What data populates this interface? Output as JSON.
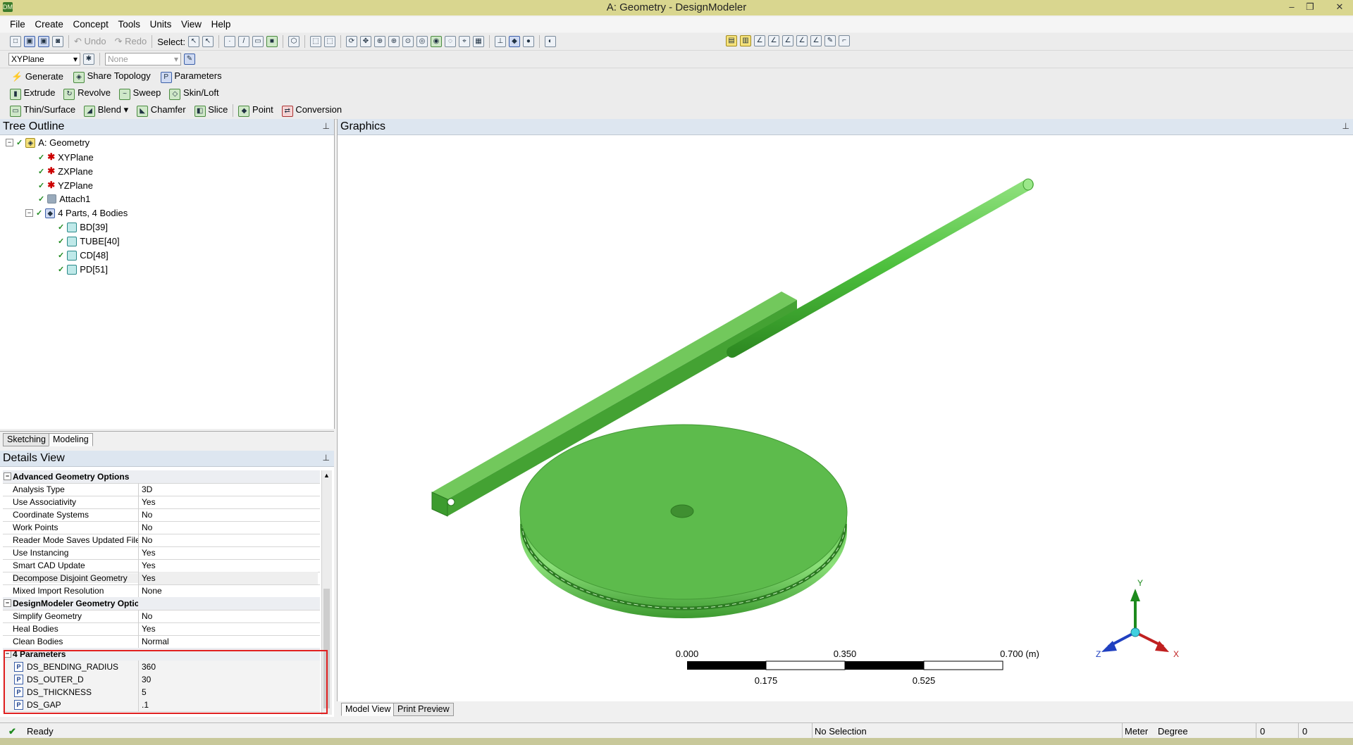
{
  "window": {
    "title": "A: Geometry - DesignModeler",
    "app_icon": "DM",
    "minimize": "–",
    "restore": "❐",
    "close": "✕"
  },
  "menu": [
    "File",
    "Create",
    "Concept",
    "Tools",
    "Units",
    "View",
    "Help"
  ],
  "toolbar1": {
    "undo": "Undo",
    "redo": "Redo",
    "select_label": "Select:"
  },
  "toolbar2": {
    "plane_combo": "XYPlane",
    "sketch_combo": "None"
  },
  "toolbar3": {
    "generate": "Generate",
    "share_topology": "Share Topology",
    "parameters": "Parameters"
  },
  "toolbar4": {
    "extrude": "Extrude",
    "revolve": "Revolve",
    "sweep": "Sweep",
    "skin_loft": "Skin/Loft"
  },
  "toolbar5": {
    "thin_surface": "Thin/Surface",
    "blend": "Blend",
    "chamfer": "Chamfer",
    "slice": "Slice",
    "point": "Point",
    "conversion": "Conversion"
  },
  "tree": {
    "title": "Tree Outline",
    "root": "A: Geometry",
    "planes": [
      "XYPlane",
      "ZXPlane",
      "YZPlane"
    ],
    "attach": "Attach1",
    "parts_label": "4 Parts, 4 Bodies",
    "bodies": [
      "BD[39]",
      "TUBE[40]",
      "CD[48]",
      "PD[51]"
    ],
    "tabs": [
      "Sketching",
      "Modeling"
    ]
  },
  "details": {
    "title": "Details View",
    "groups": [
      {
        "name": "Advanced Geometry Options",
        "rows": [
          {
            "k": "Analysis Type",
            "v": "3D"
          },
          {
            "k": "Use Associativity",
            "v": "Yes"
          },
          {
            "k": "Coordinate Systems",
            "v": "No"
          },
          {
            "k": "Work Points",
            "v": "No"
          },
          {
            "k": "Reader Mode Saves Updated File",
            "v": "No"
          },
          {
            "k": "Use Instancing",
            "v": "Yes"
          },
          {
            "k": "Smart CAD Update",
            "v": "Yes"
          },
          {
            "k": "Decompose Disjoint Geometry",
            "v": "Yes"
          },
          {
            "k": "Mixed Import Resolution",
            "v": "None"
          }
        ]
      },
      {
        "name": "DesignModeler Geometry Options",
        "rows": [
          {
            "k": "Simplify Geometry",
            "v": "No"
          },
          {
            "k": "Heal Bodies",
            "v": "Yes"
          },
          {
            "k": "Clean Bodies",
            "v": "Normal"
          }
        ]
      },
      {
        "name": "4 Parameters",
        "rows": [
          {
            "k": "DS_BENDING_RADIUS",
            "v": "360"
          },
          {
            "k": "DS_OUTER_D",
            "v": "30"
          },
          {
            "k": "DS_THICKNESS",
            "v": "5"
          },
          {
            "k": "DS_GAP",
            "v": ".1"
          }
        ]
      }
    ]
  },
  "graphics": {
    "title": "Graphics",
    "scale": {
      "t0": "0.000",
      "t1": "0.350",
      "t2": "0.700 (m)",
      "b1": "0.175",
      "b2": "0.525"
    },
    "axes": {
      "y": "Y",
      "z": "Z",
      "x": "X"
    },
    "tabs": [
      "Model View",
      "Print Preview"
    ]
  },
  "status": {
    "ready": "Ready",
    "selection": "No Selection",
    "unit_len": "Meter",
    "unit_ang": "Degree",
    "c1": "0",
    "c2": "0"
  }
}
